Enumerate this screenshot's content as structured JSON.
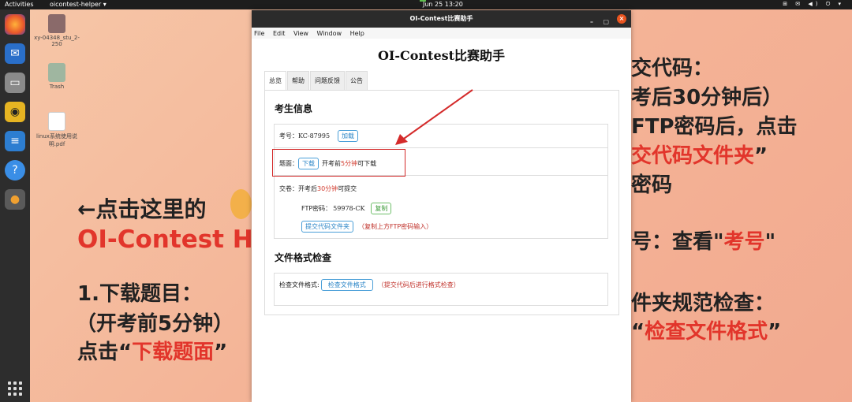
{
  "topbar": {
    "activities": "Activities",
    "app_name": "oicontest-helper ▾",
    "clock": "Jun 25  13:20",
    "tray": "⊞ ✉ ◀) ⏻ ▾"
  },
  "desktop": {
    "icons": [
      {
        "label": "xy-04348_stu_2-250"
      },
      {
        "label": "Trash"
      },
      {
        "label": "linux系统使用说明.pdf"
      }
    ]
  },
  "background": {
    "left_lines": [
      "←点击这里的",
      "OI-Contest H",
      "1.下载题目：",
      "（开考前5分钟）",
      "点击“",
      "下载题面",
      "”"
    ],
    "right_lines": [
      "交代码：",
      "考后30分钟后）",
      "FTP密码后，点击",
      "交代码文件夹",
      "”",
      "密码",
      "号：查看\"",
      "考号",
      "\"",
      "件夹规范检查：",
      "“",
      "检查文件格式",
      "”"
    ]
  },
  "window": {
    "title": "OI-Contest比赛助手",
    "menu": [
      "File",
      "Edit",
      "View",
      "Window",
      "Help"
    ],
    "app_title": "OI-Contest比赛助手",
    "tabs": [
      "总览",
      "帮助",
      "问题反馈",
      "公告"
    ],
    "section1_title": "考生信息",
    "exam_id_label": "考号：",
    "exam_id_value": "KC-87995",
    "load_btn": "加载",
    "problem_label": "题面：",
    "download_btn": "下载",
    "problem_note_a": "开考前",
    "problem_note_b": "5分钟",
    "problem_note_c": "可下载",
    "submit_label": "交卷：开考后",
    "submit_time": "30分钟",
    "submit_suffix": "可提交",
    "ftp_label": "FTP密码：",
    "ftp_value": "59978-CK",
    "copy_btn": "复制",
    "submit_folder_btn": "提交代码文件夹",
    "submit_hint": "（复制上方FTP密码输入）",
    "section2_title": "文件格式检查",
    "check_label": "检查文件格式:",
    "check_btn": "检查文件格式",
    "check_hint": "（提交代码后进行格式检查）"
  }
}
